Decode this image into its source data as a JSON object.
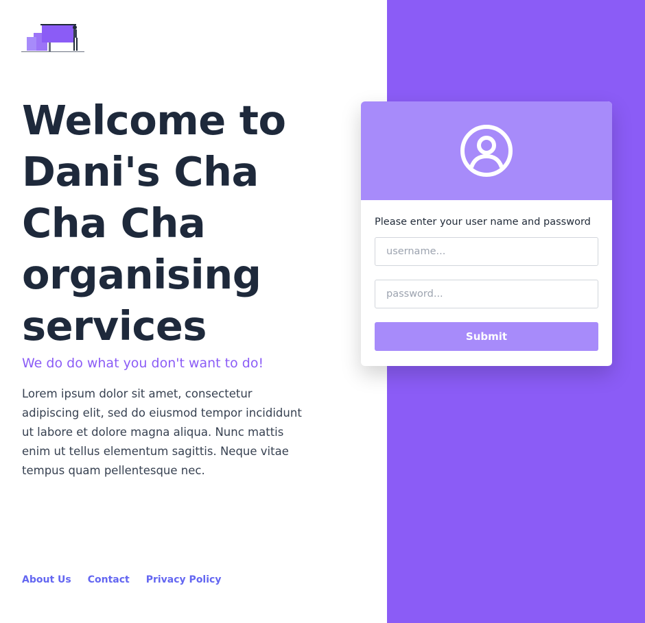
{
  "brand": {
    "logo_icon": "desk-illustration-logo"
  },
  "hero": {
    "headline": "Welcome to Dani's Cha Cha Cha organising services",
    "tagline": "We do do what you don't want to do!",
    "body": "Lorem ipsum dolor sit amet, consectetur adipiscing elit, sed do eiusmod tempor incididunt ut labore et dolore magna aliqua. Nunc mattis enim ut tellus elementum sagittis. Neque vitae tempus quam pellentesque nec."
  },
  "footer": {
    "links": [
      {
        "label": "About Us"
      },
      {
        "label": "Contact"
      },
      {
        "label": "Privacy Policy"
      }
    ]
  },
  "login": {
    "avatar_icon": "user-circle-icon",
    "prompt": "Please enter your user name and password",
    "username": {
      "placeholder": "username...",
      "value": ""
    },
    "password": {
      "placeholder": "password...",
      "value": ""
    },
    "submit_label": "Submit"
  },
  "colors": {
    "accent": "#8b5cf6",
    "card_header": "#a78bfa",
    "link": "#6366f1",
    "headline": "#1e293b"
  }
}
